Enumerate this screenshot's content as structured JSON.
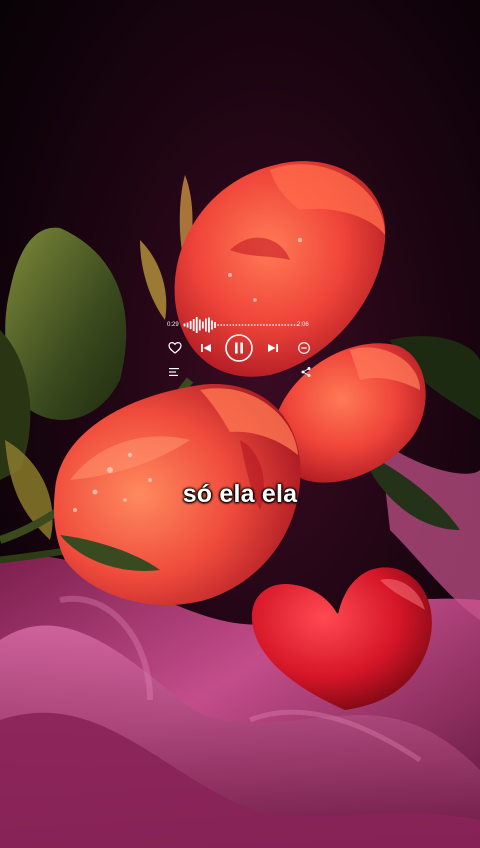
{
  "player": {
    "time_elapsed": "0:29",
    "time_total": "2:06",
    "progress": 0.28,
    "controls": {
      "like": "heart-icon",
      "previous": "skip-previous-icon",
      "play_pause": "pause-icon",
      "next": "skip-next-icon",
      "remove": "minus-circle-icon",
      "lyrics": "lyrics-icon",
      "share": "share-icon"
    }
  },
  "caption": {
    "text": "só ela ela"
  },
  "colors": {
    "rose": "#e8352e",
    "rose_highlight": "#ff6a4a",
    "satin": "#b03a78",
    "heart": "#d81c2a",
    "background": "#0a0307"
  }
}
